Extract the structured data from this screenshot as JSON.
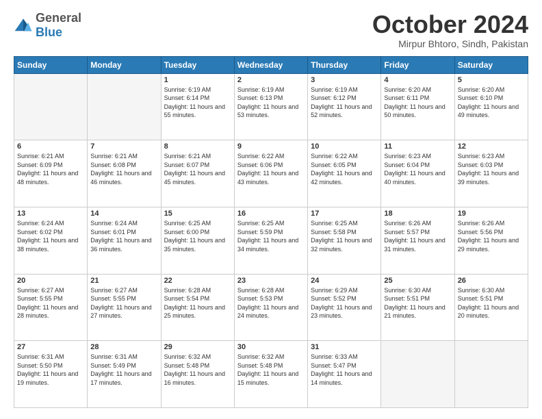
{
  "header": {
    "logo": {
      "general": "General",
      "blue": "Blue"
    },
    "title": "October 2024",
    "location": "Mirpur Bhtoro, Sindh, Pakistan"
  },
  "weekdays": [
    "Sunday",
    "Monday",
    "Tuesday",
    "Wednesday",
    "Thursday",
    "Friday",
    "Saturday"
  ],
  "weeks": [
    [
      {
        "day": "",
        "empty": true
      },
      {
        "day": "",
        "empty": true
      },
      {
        "day": "1",
        "sunrise": "6:19 AM",
        "sunset": "6:14 PM",
        "daylight": "11 hours and 55 minutes."
      },
      {
        "day": "2",
        "sunrise": "6:19 AM",
        "sunset": "6:13 PM",
        "daylight": "11 hours and 53 minutes."
      },
      {
        "day": "3",
        "sunrise": "6:19 AM",
        "sunset": "6:12 PM",
        "daylight": "11 hours and 52 minutes."
      },
      {
        "day": "4",
        "sunrise": "6:20 AM",
        "sunset": "6:11 PM",
        "daylight": "11 hours and 50 minutes."
      },
      {
        "day": "5",
        "sunrise": "6:20 AM",
        "sunset": "6:10 PM",
        "daylight": "11 hours and 49 minutes."
      }
    ],
    [
      {
        "day": "6",
        "sunrise": "6:21 AM",
        "sunset": "6:09 PM",
        "daylight": "11 hours and 48 minutes."
      },
      {
        "day": "7",
        "sunrise": "6:21 AM",
        "sunset": "6:08 PM",
        "daylight": "11 hours and 46 minutes."
      },
      {
        "day": "8",
        "sunrise": "6:21 AM",
        "sunset": "6:07 PM",
        "daylight": "11 hours and 45 minutes."
      },
      {
        "day": "9",
        "sunrise": "6:22 AM",
        "sunset": "6:06 PM",
        "daylight": "11 hours and 43 minutes."
      },
      {
        "day": "10",
        "sunrise": "6:22 AM",
        "sunset": "6:05 PM",
        "daylight": "11 hours and 42 minutes."
      },
      {
        "day": "11",
        "sunrise": "6:23 AM",
        "sunset": "6:04 PM",
        "daylight": "11 hours and 40 minutes."
      },
      {
        "day": "12",
        "sunrise": "6:23 AM",
        "sunset": "6:03 PM",
        "daylight": "11 hours and 39 minutes."
      }
    ],
    [
      {
        "day": "13",
        "sunrise": "6:24 AM",
        "sunset": "6:02 PM",
        "daylight": "11 hours and 38 minutes."
      },
      {
        "day": "14",
        "sunrise": "6:24 AM",
        "sunset": "6:01 PM",
        "daylight": "11 hours and 36 minutes."
      },
      {
        "day": "15",
        "sunrise": "6:25 AM",
        "sunset": "6:00 PM",
        "daylight": "11 hours and 35 minutes."
      },
      {
        "day": "16",
        "sunrise": "6:25 AM",
        "sunset": "5:59 PM",
        "daylight": "11 hours and 34 minutes."
      },
      {
        "day": "17",
        "sunrise": "6:25 AM",
        "sunset": "5:58 PM",
        "daylight": "11 hours and 32 minutes."
      },
      {
        "day": "18",
        "sunrise": "6:26 AM",
        "sunset": "5:57 PM",
        "daylight": "11 hours and 31 minutes."
      },
      {
        "day": "19",
        "sunrise": "6:26 AM",
        "sunset": "5:56 PM",
        "daylight": "11 hours and 29 minutes."
      }
    ],
    [
      {
        "day": "20",
        "sunrise": "6:27 AM",
        "sunset": "5:55 PM",
        "daylight": "11 hours and 28 minutes."
      },
      {
        "day": "21",
        "sunrise": "6:27 AM",
        "sunset": "5:55 PM",
        "daylight": "11 hours and 27 minutes."
      },
      {
        "day": "22",
        "sunrise": "6:28 AM",
        "sunset": "5:54 PM",
        "daylight": "11 hours and 25 minutes."
      },
      {
        "day": "23",
        "sunrise": "6:28 AM",
        "sunset": "5:53 PM",
        "daylight": "11 hours and 24 minutes."
      },
      {
        "day": "24",
        "sunrise": "6:29 AM",
        "sunset": "5:52 PM",
        "daylight": "11 hours and 23 minutes."
      },
      {
        "day": "25",
        "sunrise": "6:30 AM",
        "sunset": "5:51 PM",
        "daylight": "11 hours and 21 minutes."
      },
      {
        "day": "26",
        "sunrise": "6:30 AM",
        "sunset": "5:51 PM",
        "daylight": "11 hours and 20 minutes."
      }
    ],
    [
      {
        "day": "27",
        "sunrise": "6:31 AM",
        "sunset": "5:50 PM",
        "daylight": "11 hours and 19 minutes."
      },
      {
        "day": "28",
        "sunrise": "6:31 AM",
        "sunset": "5:49 PM",
        "daylight": "11 hours and 17 minutes."
      },
      {
        "day": "29",
        "sunrise": "6:32 AM",
        "sunset": "5:48 PM",
        "daylight": "11 hours and 16 minutes."
      },
      {
        "day": "30",
        "sunrise": "6:32 AM",
        "sunset": "5:48 PM",
        "daylight": "11 hours and 15 minutes."
      },
      {
        "day": "31",
        "sunrise": "6:33 AM",
        "sunset": "5:47 PM",
        "daylight": "11 hours and 14 minutes."
      },
      {
        "day": "",
        "empty": true
      },
      {
        "day": "",
        "empty": true
      }
    ]
  ],
  "labels": {
    "sunrise": "Sunrise:",
    "sunset": "Sunset:",
    "daylight": "Daylight:"
  }
}
